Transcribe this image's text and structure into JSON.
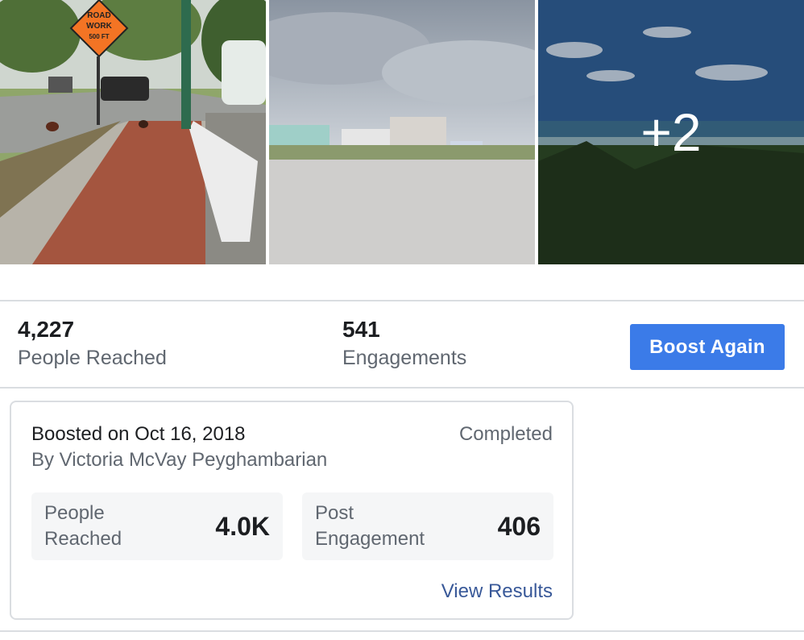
{
  "photos": {
    "more_count": "+2",
    "photo1_sign": [
      "ROAD",
      "WORK",
      "500 FT"
    ]
  },
  "stats": {
    "people_reached_value": "4,227",
    "people_reached_label": "People Reached",
    "engagements_value": "541",
    "engagements_label": "Engagements",
    "boost_button_label": "Boost Again"
  },
  "boost_card": {
    "title": "Boosted on Oct 16, 2018",
    "status": "Completed",
    "author": "By Victoria McVay Peyghambarian",
    "metrics": [
      {
        "label": "People Reached",
        "value": "4.0K"
      },
      {
        "label": "Post Engagement",
        "value": "406"
      }
    ],
    "view_results_label": "View Results"
  },
  "colors": {
    "boost_button": "#3b7be8",
    "link": "#385898",
    "secondary_text": "#606770"
  }
}
